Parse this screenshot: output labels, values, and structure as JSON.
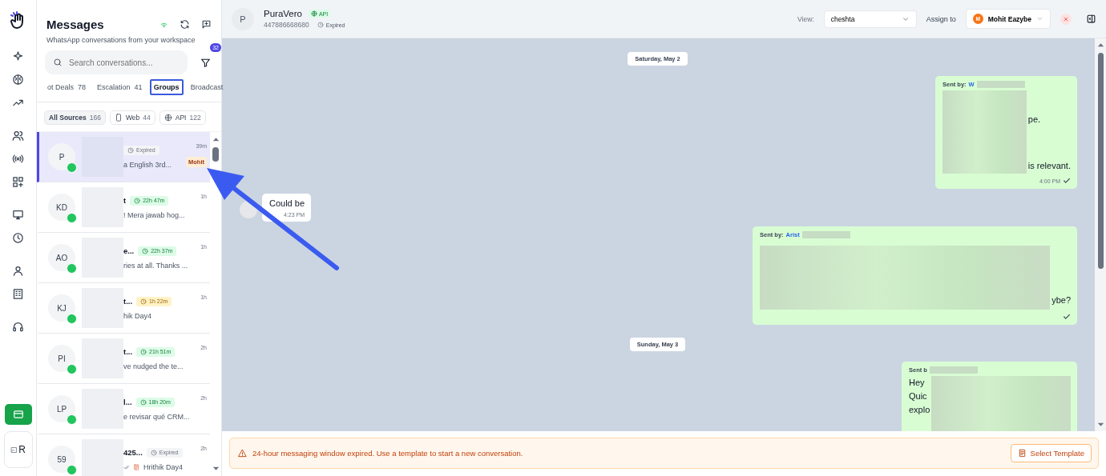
{
  "rail": {
    "profile_alt": "R"
  },
  "messages": {
    "title": "Messages",
    "subtitle": "WhatsApp conversations from your workspace",
    "search_placeholder": "Search conversations...",
    "filter_count": "32",
    "tabs": [
      {
        "label": "ot Deals",
        "count": "78",
        "selected": false
      },
      {
        "label": "Escalation",
        "count": "41",
        "selected": false
      },
      {
        "label": "Groups",
        "selected": true
      },
      {
        "label": "Broadcast",
        "selected": false
      }
    ],
    "sources": [
      {
        "kind": "all",
        "label": "All Sources",
        "count": "166",
        "selected": true
      },
      {
        "kind": "web",
        "label": "Web",
        "count": "44",
        "selected": false
      },
      {
        "kind": "api",
        "label": "API",
        "count": "122",
        "selected": false
      }
    ],
    "conversations": [
      {
        "initials": "P",
        "status": {
          "kind": "expired",
          "text": "Expired"
        },
        "preview": "a English 3rd...",
        "time": "39m",
        "tag": "Mohit",
        "selected": true,
        "outgoing": false
      },
      {
        "initials": "KD",
        "name": "t",
        "status": {
          "kind": "ok",
          "text": "22h 47m"
        },
        "preview": "! Mera jawab hog...",
        "time": "1h",
        "selected": false,
        "outgoing": false
      },
      {
        "initials": "AO",
        "name": "e...",
        "status": {
          "kind": "ok",
          "text": "22h 37m"
        },
        "preview": "ries at all. Thanks ...",
        "time": "1h",
        "selected": false,
        "outgoing": false
      },
      {
        "initials": "KJ",
        "name": "t...",
        "status": {
          "kind": "warn",
          "text": "1h 22m"
        },
        "preview": "hik Day4",
        "time": "1h",
        "selected": false,
        "outgoing": false
      },
      {
        "initials": "PI",
        "name": "t...",
        "status": {
          "kind": "ok",
          "text": "21h 51m"
        },
        "preview": "ve nudged the te...",
        "time": "2h",
        "selected": false,
        "outgoing": false
      },
      {
        "initials": "LP",
        "name": "l...",
        "status": {
          "kind": "ok",
          "text": "18h 20m"
        },
        "preview": "e revisar qué CRM...",
        "time": "2h",
        "selected": false,
        "outgoing": false
      },
      {
        "initials": "59",
        "name": "425...",
        "status": {
          "kind": "expired",
          "text": "Expired"
        },
        "preview": "Hrithik Day4",
        "time": "2h",
        "selected": false,
        "outgoing": true
      }
    ]
  },
  "chat_header": {
    "initials": "P",
    "name": "PuraVero",
    "source_badge": "API",
    "phone": "447886668680",
    "status": "Expired",
    "view_label": "View:",
    "view_value": "cheshta",
    "assign_label": "Assign to",
    "assignee_initial": "M",
    "assignee": "Mohit Eazybe"
  },
  "chat": [
    {
      "kind": "date",
      "text": "Saturday, May 2"
    },
    {
      "kind": "outgoing",
      "sender_label": "Sent by:",
      "sender": "W",
      "right_lines": [
        "pe.",
        "is relevant."
      ],
      "time": "4:00 PM",
      "read": true
    },
    {
      "kind": "incoming",
      "text": "Could be",
      "time": "4:23 PM"
    },
    {
      "kind": "outgoing",
      "sender_label": "Sent by:",
      "sender": "Arist",
      "right_lines": [
        "ybe?"
      ],
      "read": true
    },
    {
      "kind": "date",
      "text": "Sunday, May 3"
    },
    {
      "kind": "outgoing",
      "sender_label": "Sent b",
      "left_lines": [
        "Hey",
        "Quic",
        "explo"
      ]
    }
  ],
  "banner": {
    "text": "24-hour messaging window expired. Use a template to start a new conversation.",
    "button": "Select Template"
  }
}
